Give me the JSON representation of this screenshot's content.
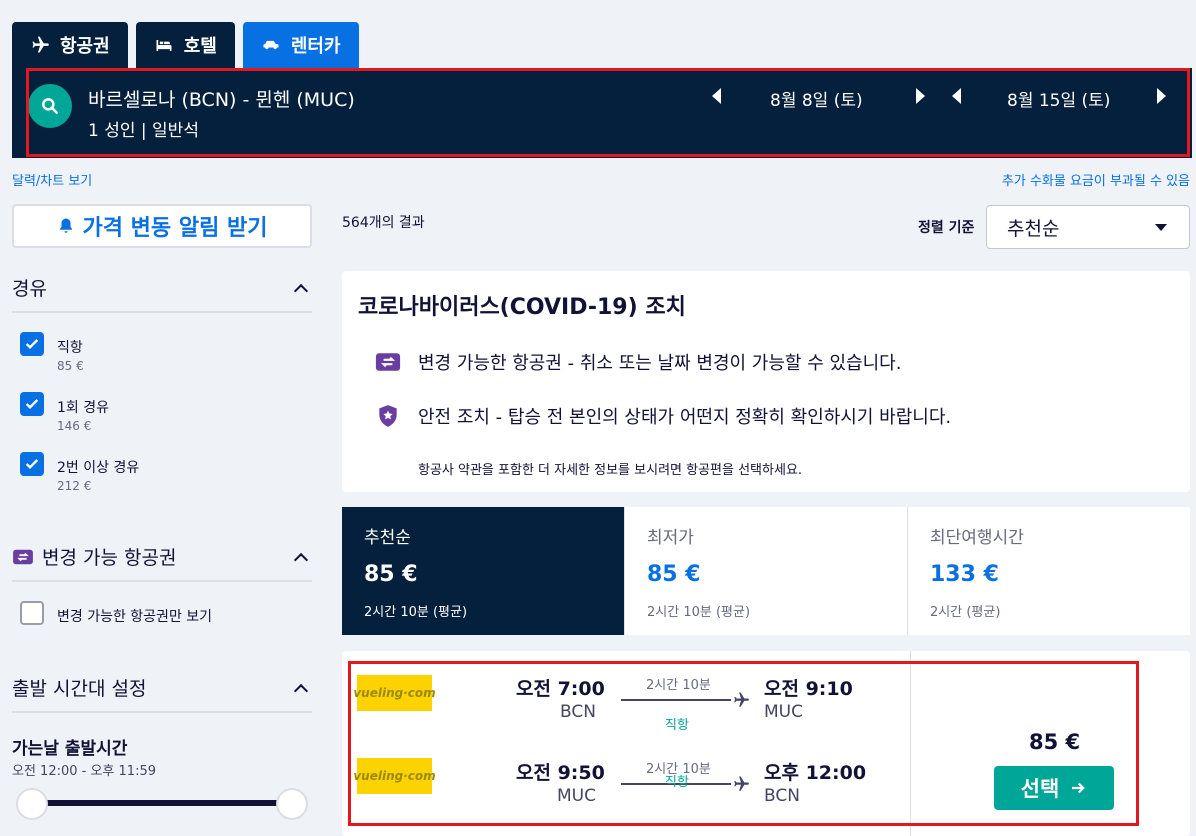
{
  "tabs": [
    {
      "label": "항공권",
      "icon": "plane-icon",
      "active": false
    },
    {
      "label": "호텔",
      "icon": "bed-icon",
      "active": false
    },
    {
      "label": "렌터카",
      "icon": "car-icon",
      "active": true
    }
  ],
  "search": {
    "route": "바르셀로나 (BCN) - 뮌헨 (MUC)",
    "passengers": "1 성인 | 일반석",
    "depart_date": "8월 8일 (토)",
    "return_date": "8월 15일 (토)"
  },
  "links": {
    "calendar": "달력/차트 보기",
    "fees": "추가 수화물 요금이 부과될 수 있음"
  },
  "sidebar": {
    "alert_button": "가격 변동 알림 받기",
    "stops": {
      "title": "경유",
      "options": [
        {
          "label": "직항",
          "price": "85 €",
          "checked": true
        },
        {
          "label": "1회 경유",
          "price": "146 €",
          "checked": true
        },
        {
          "label": "2번 이상 경유",
          "price": "212 €",
          "checked": true
        }
      ]
    },
    "flexible": {
      "title": "변경 가능 항공권",
      "option": "변경 가능한 항공권만 보기"
    },
    "departure_time": {
      "title": "출발 시간대 설정",
      "subtitle": "가는날 출발시간",
      "range": "오전 12:00 - 오후 11:59"
    }
  },
  "results": {
    "count": "564개의 결과",
    "sort_label": "정렬 기준",
    "sort_value": "추천순"
  },
  "covid": {
    "title": "코로나바이러스(COVID-19) 조치",
    "line1": "변경 가능한 항공권 - 취소 또는 날짜 변경이 가능할 수 있습니다.",
    "line2": "안전 조치 - 탑승 전 본인의 상태가 어떤지 정확히 확인하시기 바랍니다.",
    "note": "항공사 약관을 포함한 더 자세한 정보를 보시려면 항공편을 선택하세요."
  },
  "sort_tabs": [
    {
      "title": "추천순",
      "price": "85 €",
      "sub": "2시간 10분 (평균)",
      "active": true
    },
    {
      "title": "최저가",
      "price": "85 €",
      "sub": "2시간 10분 (평균)",
      "active": false
    },
    {
      "title": "최단여행시간",
      "price": "133 €",
      "sub": "2시간 (평균)",
      "active": false
    }
  ],
  "flight": {
    "airline_logo_text": "vueling·com",
    "outbound": {
      "dep_time": "오전 7:00",
      "dep_code": "BCN",
      "duration": "2시간 10분",
      "stops": "직항",
      "arr_time": "오전 9:10",
      "arr_code": "MUC"
    },
    "inbound": {
      "dep_time": "오전 9:50",
      "dep_code": "MUC",
      "duration": "2시간 10분",
      "stops": "직항",
      "arr_time": "오후 12:00",
      "arr_code": "BCN"
    },
    "price": "85 €",
    "select_label": "선택"
  },
  "colors": {
    "navy": "#05203c",
    "blue": "#0770e3",
    "teal": "#00a698",
    "highlight": "#e2171f"
  }
}
